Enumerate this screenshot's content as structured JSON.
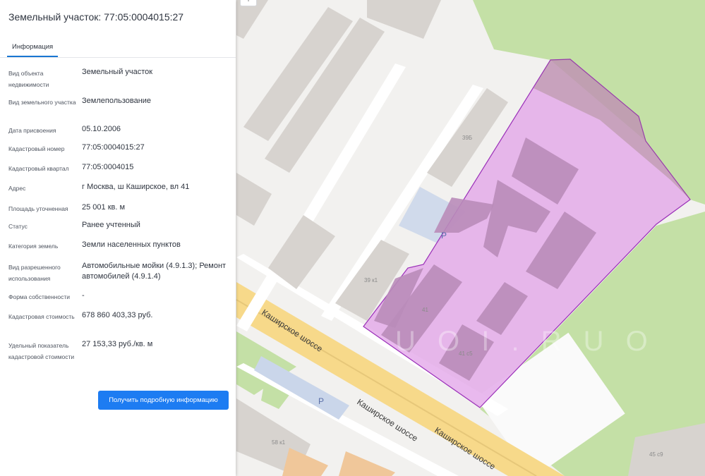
{
  "panel": {
    "breadcrumb": "· · ·",
    "title": "Земельный участок: 77:05:0004015:27",
    "tab": "Информация",
    "rows": [
      {
        "label": "Вид объекта недвижимости",
        "value": "Земельный участок"
      },
      {
        "label": "Вид земельного участка",
        "value": "Землепользование"
      },
      {
        "label": "Дата присвоения",
        "value": "05.10.2006"
      },
      {
        "label": "Кадастровый номер",
        "value": "77:05:0004015:27"
      },
      {
        "label": "Кадастровый квартал",
        "value": "77:05:0004015"
      },
      {
        "label": "Адрес",
        "value": "г Москва, ш Каширское, вл 41"
      },
      {
        "label": "Площадь уточненная",
        "value": "25 001 кв. м"
      },
      {
        "label": "Статус",
        "value": "Ранее учтенный"
      },
      {
        "label": "Категория земель",
        "value": "Земли населенных пунктов"
      },
      {
        "label": "Вид разрешенного использования",
        "value": "Автомобильные мойки (4.9.1.3); Ремонт автомобилей (4.9.1.4)"
      },
      {
        "label": "Форма собственности",
        "value": "-"
      },
      {
        "label": "Кадастровая стоимость",
        "value": "678 860 403,33 руб."
      },
      {
        "label": "Удельный показатель кадастровой стоимости",
        "value": "27 153,33 руб./кв. м"
      }
    ],
    "button": "Получить подробную информацию"
  },
  "map": {
    "zoom_control": "+",
    "road_labels": [
      "Каширское шоссе",
      "Каширское шоссе",
      "Каширское шоссе"
    ],
    "building_labels": [
      "39Б",
      "39 к1",
      "41",
      "41 с5",
      "58 к1",
      "45 с9"
    ],
    "parking_labels": [
      "P",
      "P"
    ],
    "watermark": "U  O I . R U  O",
    "colors": {
      "parcel_fill": "#e2a2e8",
      "parcel_stroke": "#9a2fb8",
      "greenery": "#c4e0a6",
      "road": "#f7d98a",
      "building": "#d7d3cf"
    }
  }
}
